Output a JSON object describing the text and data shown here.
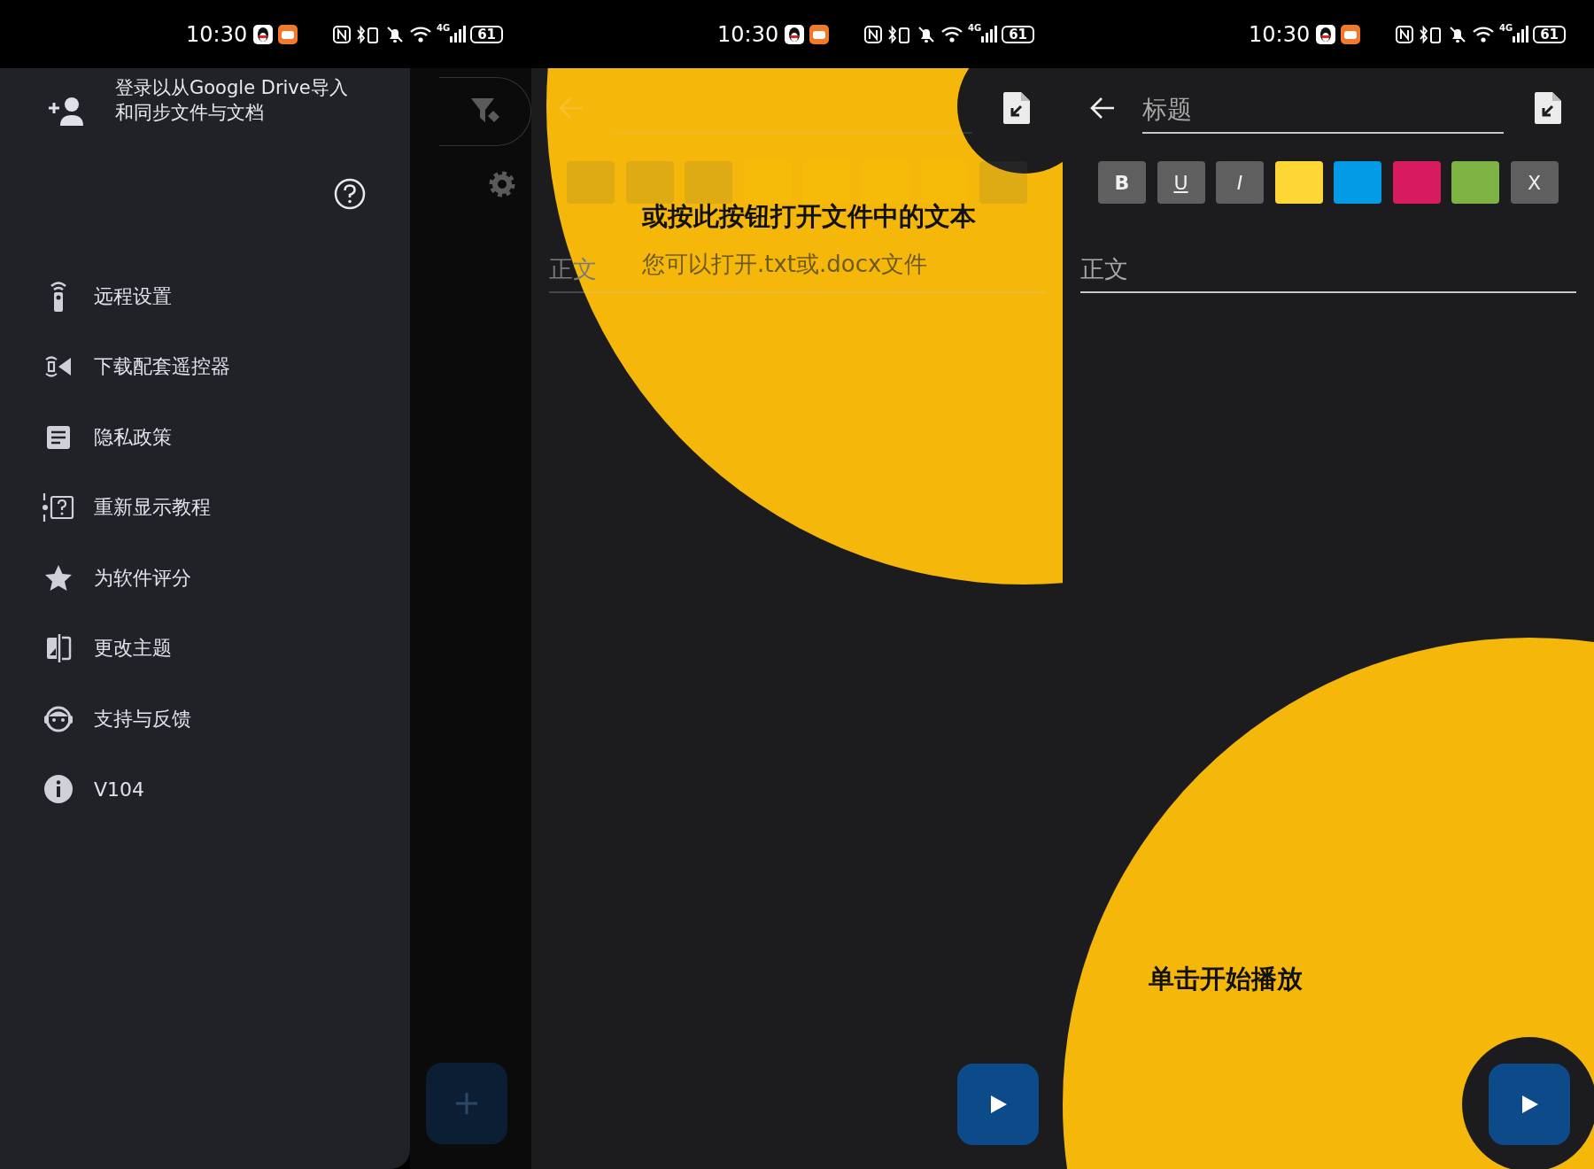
{
  "screens": [
    {
      "kind": "drawer",
      "status_bar": {
        "time": "10:30",
        "network": "4G",
        "battery": "61"
      },
      "drawer": {
        "account_prompt": [
          "登录以从Google Drive导入",
          "和同步文件与文档"
        ],
        "items": [
          {
            "label": "远程设置"
          },
          {
            "label": "下载配套遥控器"
          },
          {
            "label": "隐私政策"
          },
          {
            "label": "重新显示教程"
          },
          {
            "label": "为软件评分"
          },
          {
            "label": "更改主题"
          },
          {
            "label": "支持与反馈"
          },
          {
            "label": "V104"
          }
        ]
      }
    },
    {
      "kind": "editor",
      "status_bar": {
        "time": "10:30",
        "network": "4G",
        "battery": "61"
      },
      "editor": {
        "format_buttons": [
          {
            "kind": "bold"
          },
          {
            "kind": "underline"
          },
          {
            "kind": "italic"
          },
          {
            "kind": "color"
          },
          {
            "kind": "color"
          },
          {
            "kind": "color"
          },
          {
            "kind": "color"
          },
          {
            "kind": "clear"
          }
        ],
        "body_placeholder": "正文"
      },
      "tutorial": {
        "kind": "file",
        "title": "或按此按钮打开文件中的文本",
        "subtitle": "您可以打开.txt或.docx文件"
      }
    },
    {
      "kind": "editor",
      "status_bar": {
        "time": "10:30",
        "network": "4G",
        "battery": "61"
      },
      "editor": {
        "title_placeholder": "标题",
        "format_buttons": [
          {
            "kind": "bold",
            "label": "B"
          },
          {
            "kind": "underline",
            "label": "U"
          },
          {
            "kind": "italic",
            "label": "I"
          },
          {
            "kind": "color",
            "color": "#fdd835"
          },
          {
            "kind": "color",
            "color": "#039be5"
          },
          {
            "kind": "color",
            "color": "#d81b60"
          },
          {
            "kind": "color",
            "color": "#7cb342"
          },
          {
            "kind": "clear",
            "label": "X"
          }
        ],
        "body_placeholder": "正文"
      },
      "tutorial": {
        "kind": "play",
        "title": "单击开始播放"
      }
    }
  ]
}
